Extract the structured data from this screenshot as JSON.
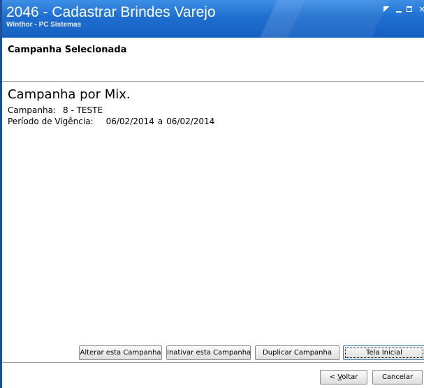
{
  "window": {
    "title": "2046 - Cadastrar Brindes Varejo",
    "subtitle": "Winthor - PC Sistemas",
    "controls": {
      "restore_icon": "restore-icon",
      "minimize_icon": "minimize-icon",
      "maximize_icon": "maximize-icon",
      "close_glyph": "×"
    },
    "accent_color": "#1f6fd0"
  },
  "header": {
    "section_title": "Campanha Selecionada"
  },
  "content": {
    "campaign_type": "Campanha por Mix.",
    "campaign_label": "Campanha:",
    "campaign_value": "8 - TESTE",
    "period_label": "Período de Vigência:",
    "period_start": "06/02/2014",
    "period_separator": "a",
    "period_end": "06/02/2014"
  },
  "actions": {
    "alterar": "Alterar esta Campanha",
    "inativar": "Inativar esta Campanha",
    "duplicar": "Duplicar Campanha",
    "tela_inicial": "Tela Inicial"
  },
  "footer": {
    "voltar_prefix": "< ",
    "voltar_accel": "V",
    "voltar_rest": "oltar",
    "cancelar": "Cancelar"
  }
}
